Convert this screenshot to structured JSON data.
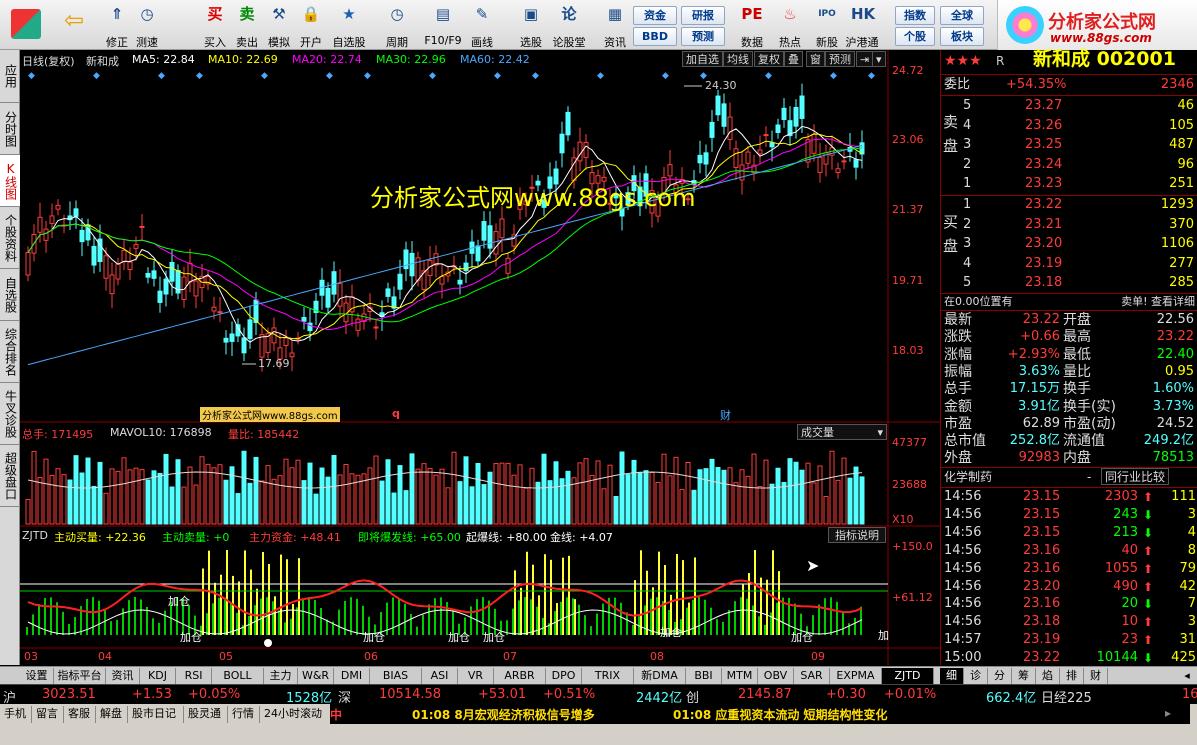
{
  "toolbar": {
    "buttons": [
      {
        "label": "修正",
        "icon": "chevron-up-icon"
      },
      {
        "label": "测速",
        "icon": "clock-icon"
      },
      {
        "label": "买入",
        "icon": "buy-icon"
      },
      {
        "label": "卖出",
        "icon": "sell-icon"
      },
      {
        "label": "模拟",
        "icon": "hammer-icon"
      },
      {
        "label": "开户",
        "icon": "lock-icon"
      },
      {
        "label": "自选股",
        "icon": "star-icon"
      },
      {
        "label": "周期",
        "icon": "clock-icon"
      },
      {
        "label": "F10/F9",
        "icon": "window-icon"
      },
      {
        "label": "画线",
        "icon": "pencil-icon"
      },
      {
        "label": "选股",
        "icon": "screen-icon"
      },
      {
        "label": "论股堂",
        "icon": "forum-icon"
      },
      {
        "label": "资讯",
        "icon": "news-icon"
      },
      {
        "label": "数据",
        "icon": "pe-icon"
      },
      {
        "label": "热点",
        "icon": "flame-icon"
      },
      {
        "label": "新股",
        "icon": "ipo-icon"
      },
      {
        "label": "沪港通",
        "icon": "hk-icon"
      }
    ],
    "small_buttons": [
      "资金",
      "研报",
      "BBD",
      "预测",
      "指数",
      "全球",
      "个股",
      "板块"
    ]
  },
  "logo": {
    "title": "分析家公式网",
    "url": "www.88gs.com"
  },
  "left_tabs": [
    "应用",
    "分时图",
    "K线图",
    "个股资料",
    "自选股",
    "综合排名",
    "牛叉诊股",
    "超级盘口"
  ],
  "chart": {
    "header": {
      "period": "日线(复权)",
      "name": "新和成",
      "ma5": "MA5: 22.84",
      "ma10": "MA10: 22.69",
      "ma20": "MA20: 22.74",
      "ma30": "MA30: 22.96",
      "ma60": "MA60: 22.42"
    },
    "header_buttons": [
      "加自选",
      "均线",
      "复权",
      "叠",
      "窗",
      "预测"
    ],
    "price_axis": [
      "24.72",
      "23.06",
      "21.37",
      "19.71",
      "18.03"
    ],
    "high_label": "24.30",
    "low_label": "17.69",
    "watermark": "分析家公式网www.88gs.com",
    "small_watermark": "分析家公式网www.88gs.com",
    "marks": [
      "q",
      "财"
    ],
    "vol_header": {
      "total": "总手: 171495",
      "mavol": "MAVOL10: 176898",
      "ratio": "量比: 185442"
    },
    "vol_dropdown": "成交量",
    "vol_axis": [
      "47377",
      "23688",
      "X10"
    ],
    "ind_header": {
      "name": "ZJTD",
      "buy": "主动买量: +22.36",
      "sell": "主动卖量: +0",
      "fund": "主力资金: +48.41",
      "burst": "即将爆发线: +65.00",
      "start": "起爆线: +80.00",
      "gold": "金线: +4.07"
    },
    "ind_button": "指标说明",
    "ind_axis": [
      "+150.0",
      "+61.12"
    ],
    "ind_labels": [
      "加仓",
      "加仓",
      "加仓",
      "加仓",
      "加仓",
      "加仓",
      "加仓",
      "加"
    ],
    "months": [
      "03",
      "04",
      "05",
      "06",
      "07",
      "08",
      "09"
    ]
  },
  "quote": {
    "title": "新和成 002001",
    "webi_label": "委比",
    "webi_value": "+54.35%",
    "webi_diff": "2346",
    "sell_label": "卖盘",
    "buy_label": "买盘",
    "sell": [
      {
        "n": "5",
        "price": "23.27",
        "vol": "46"
      },
      {
        "n": "4",
        "price": "23.26",
        "vol": "105"
      },
      {
        "n": "3",
        "price": "23.25",
        "vol": "487"
      },
      {
        "n": "2",
        "price": "23.24",
        "vol": "96"
      },
      {
        "n": "1",
        "price": "23.23",
        "vol": "251"
      }
    ],
    "buy": [
      {
        "n": "1",
        "price": "23.22",
        "vol": "1293"
      },
      {
        "n": "2",
        "price": "23.21",
        "vol": "370"
      },
      {
        "n": "3",
        "price": "23.20",
        "vol": "1106"
      },
      {
        "n": "4",
        "price": "23.19",
        "vol": "277"
      },
      {
        "n": "5",
        "price": "23.18",
        "vol": "285"
      }
    ],
    "position_note": "在0.00位置有",
    "order_links": "卖单! 查看详细",
    "stats": [
      {
        "l1": "最新",
        "v1": "23.22",
        "l2": "开盘",
        "v2": "22.56"
      },
      {
        "l1": "涨跌",
        "v1": "+0.66",
        "l2": "最高",
        "v2": "23.22"
      },
      {
        "l1": "涨幅",
        "v1": "+2.93%",
        "l2": "最低",
        "v2": "22.40"
      },
      {
        "l1": "振幅",
        "v1": "3.63%",
        "l2": "量比",
        "v2": "0.95"
      },
      {
        "l1": "总手",
        "v1": "17.15万",
        "l2": "换手",
        "v2": "1.60%"
      },
      {
        "l1": "金额",
        "v1": "3.91亿",
        "l2": "换手(实)",
        "v2": "3.73%"
      },
      {
        "l1": "市盈",
        "v1": "62.89",
        "l2": "市盈(动)",
        "v2": "24.52"
      },
      {
        "l1": "总市值",
        "v1": "252.8亿",
        "l2": "流通值",
        "v2": "249.2亿"
      },
      {
        "l1": "外盘",
        "v1": "92983",
        "l2": "内盘",
        "v2": "78513"
      }
    ],
    "industry": "化学制药",
    "industry_compare": "同行业比较",
    "ticks": [
      {
        "t": "14:56",
        "p": "23.15",
        "v": "2303",
        "d": "up",
        "x": "111"
      },
      {
        "t": "14:56",
        "p": "23.15",
        "v": "243",
        "d": "down",
        "x": "3"
      },
      {
        "t": "14:56",
        "p": "23.15",
        "v": "213",
        "d": "down",
        "x": "4"
      },
      {
        "t": "14:56",
        "p": "23.16",
        "v": "40",
        "d": "up",
        "x": "8"
      },
      {
        "t": "14:56",
        "p": "23.16",
        "v": "1055",
        "d": "up",
        "x": "79"
      },
      {
        "t": "14:56",
        "p": "23.20",
        "v": "490",
        "d": "up",
        "x": "42"
      },
      {
        "t": "14:56",
        "p": "23.16",
        "v": "20",
        "d": "down",
        "x": "7"
      },
      {
        "t": "14:56",
        "p": "23.18",
        "v": "10",
        "d": "up",
        "x": "3"
      },
      {
        "t": "14:57",
        "p": "23.19",
        "v": "23",
        "d": "up",
        "x": "31"
      },
      {
        "t": "15:00",
        "p": "23.22",
        "v": "10144",
        "d": "down",
        "x": "425"
      }
    ],
    "bottom_tabs": [
      "细",
      "诊",
      "分",
      "筹",
      "焰",
      "排",
      "财"
    ]
  },
  "bottom_tabs": [
    "设置",
    "指标平台",
    "资讯",
    "KDJ",
    "RSI",
    "BOLL",
    "主力",
    "W&R",
    "DMI",
    "BIAS",
    "ASI",
    "VR",
    "ARBR",
    "DPO",
    "TRIX",
    "新DMA",
    "BBI",
    "MTM",
    "OBV",
    "SAR",
    "EXPMA",
    "ZJTD"
  ],
  "indices": {
    "sh_label": "沪",
    "sh_val": "3023.51",
    "sh_chg": "+1.53",
    "sh_pct": "+0.05%",
    "sh_amt": "1528亿",
    "sz_label": "深",
    "sz_val": "10514.58",
    "sz_chg": "+53.01",
    "sz_pct": "+0.51%",
    "sz_amt": "2442亿",
    "cy_label": "创",
    "cy_val": "2145.87",
    "cy_chg": "+0.30",
    "cy_pct": "+0.01%",
    "cy_amt": "662.4亿",
    "nk_label": "日经225",
    "nk_val": "16"
  },
  "status": {
    "items": [
      "手机",
      "留言",
      "客服",
      "解盘",
      "股市日记",
      "股灵通",
      "行情",
      "24小时滚动"
    ],
    "mid": "中",
    "news1": "01:08 8月宏观经济积极信号增多",
    "news2": "01:08 应重视资本流动 短期结构性变化"
  },
  "colors": {
    "up": "#ff3b3b",
    "down": "#54ffff",
    "ma5": "#ffffff",
    "ma10": "#ffff00",
    "ma20": "#ff00ff",
    "ma30": "#00ff00",
    "ma60": "#4aa8ff"
  }
}
